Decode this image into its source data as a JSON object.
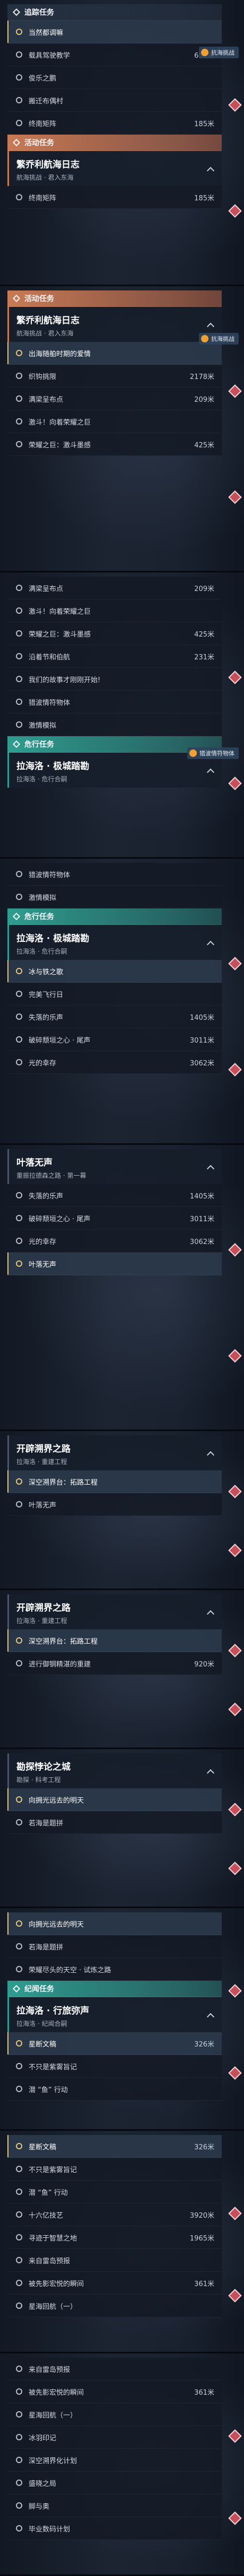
{
  "strips": [
    {
      "header": {
        "style": "dark",
        "label": "追踪任务"
      },
      "rows": [
        {
          "label": "当然都调嘛",
          "state": "active"
        },
        {
          "label": "载具驾驶教学",
          "dist": "651米"
        },
        {
          "label": "俊乐之鹏"
        },
        {
          "label": "搬迁布偶村"
        },
        {
          "label": "终南矩阵",
          "dist": "185米"
        }
      ],
      "after": {
        "style": "orange",
        "label": "活动任务"
      },
      "card": {
        "title": "繁乔利航海日志",
        "sub": "航海挑战 · 君入东海"
      },
      "tag": "抗海挑战",
      "tail": [
        {
          "label": "终南矩阵",
          "dist": "185米"
        }
      ]
    },
    {
      "header": {
        "style": "orange",
        "label": "活动任务"
      },
      "card": {
        "title": "繁乔利航海日志",
        "sub": "航海挑战 · 君入东海"
      },
      "tag": "抗海挑战",
      "rows": [
        {
          "label": "出海随舶时期的爱情",
          "state": "active"
        },
        {
          "label": "织钩挑限",
          "dist": "2178米"
        },
        {
          "label": "满梁呈布点",
          "dist": "209米"
        },
        {
          "label": "激斗！向着荣耀之巨"
        },
        {
          "label": "荣耀之巨：激斗墨感",
          "dist": "425米"
        }
      ]
    },
    {
      "rows": [
        {
          "label": "满梁呈布点",
          "dist": "209米"
        },
        {
          "label": "激斗！向着荣耀之巨"
        },
        {
          "label": "荣耀之巨：激斗墨感",
          "dist": "425米"
        },
        {
          "label": "沿着节和伯航",
          "dist": "231米"
        },
        {
          "label": "我们的故事才刚刚开始!"
        },
        {
          "label": "猎波情符物体"
        },
        {
          "label": "激情模拟"
        }
      ],
      "tag": "猎波情符物体",
      "after": {
        "style": "teal",
        "label": "危行任务"
      },
      "card": {
        "title": "拉海洛 · 极城踏勘",
        "sub": "拉海洛 · 危行合嗣"
      }
    },
    {
      "rows": [
        {
          "label": "猎波情符物体"
        },
        {
          "label": "激情模拟"
        }
      ],
      "after": {
        "style": "teal",
        "label": "危行任务"
      },
      "card": {
        "title": "拉海洛 · 极城踏勘",
        "sub": "拉海洛 · 危行合嗣"
      },
      "tail": [
        {
          "label": "冰与铁之歌",
          "state": "active"
        },
        {
          "label": "完美飞行日"
        },
        {
          "label": "失落的乐声",
          "dist": "1405米"
        },
        {
          "label": "破碎颓垣之心 · 尾声",
          "dist": "3011米"
        },
        {
          "label": "光的幸存",
          "dist": "3062米"
        }
      ]
    },
    {
      "rows": [
        {
          "label": "失落的乐声",
          "dist": "1405米"
        },
        {
          "label": "破碎颓垣之心 · 尾声",
          "dist": "3011米"
        },
        {
          "label": "光的幸存",
          "dist": "3062米"
        }
      ],
      "card": {
        "title": "叶落无声",
        "sub": "重振拉德森之路 · 第一幕"
      },
      "tail": [
        {
          "label": "叶落无声",
          "state": "active"
        }
      ]
    },
    {
      "card": {
        "title": "开辟溯界之路",
        "sub": "拉海洛 · 重建工程"
      },
      "rows": [
        {
          "label": "深空溯界台：拓路工程",
          "state": "active"
        },
        {
          "label": "叶落无声"
        }
      ]
    },
    {
      "card": {
        "title": "开辟溯界之路",
        "sub": "拉海洛 · 重建工程"
      },
      "rows": [
        {
          "label": "深空溯界台：拓路工程",
          "state": "active"
        },
        {
          "label": "进行御钢精湛的重建",
          "dist": "920米"
        }
      ]
    },
    {
      "card": {
        "title": "勘探悖论之城",
        "sub": "勘探 · 科考工程"
      },
      "rows": [
        {
          "label": "向拥光远去的明天",
          "state": "active"
        },
        {
          "label": "若海是题拼"
        }
      ]
    },
    {
      "rows": [
        {
          "label": "向拥光远去的明天",
          "state": "active"
        },
        {
          "label": "若海是题拼"
        },
        {
          "label": "荣耀尽头的天空 · 试炼之路"
        }
      ],
      "after": {
        "style": "teal",
        "label": "纪闻任务"
      },
      "card": {
        "title": "拉海洛 · 行旅弥声",
        "sub": "拉海洛 · 纪闻合嗣"
      },
      "tail": [
        {
          "label": "星断文稿",
          "dist": "326米",
          "state": "active"
        },
        {
          "label": "不只是紫雾旨记"
        },
        {
          "label": "潜 “鱼” 行动"
        }
      ]
    },
    {
      "rows": [
        {
          "label": "星断文稿",
          "dist": "326米",
          "state": "active"
        },
        {
          "label": "不只是紫雾旨记"
        },
        {
          "label": "潜 “鱼” 行动"
        },
        {
          "label": "十六亿技艺",
          "dist": "3920米"
        },
        {
          "label": "寻迹于智慧之地",
          "dist": "1965米"
        },
        {
          "label": "来自雷岛预报"
        },
        {
          "label": "被先影宏悦的瞬间",
          "dist": "361米"
        },
        {
          "label": "星海回航（一）"
        }
      ]
    },
    {
      "rows": [
        {
          "label": "来自雷岛预报"
        },
        {
          "label": "被先影宏悦的瞬间",
          "dist": "361米"
        },
        {
          "label": "星海回航（一）"
        },
        {
          "label": "冰羽印记"
        },
        {
          "label": "深空溯界化计划"
        },
        {
          "label": "盛晓之局"
        },
        {
          "label": "脚与奥"
        },
        {
          "label": "毕业数码计划"
        }
      ]
    }
  ]
}
